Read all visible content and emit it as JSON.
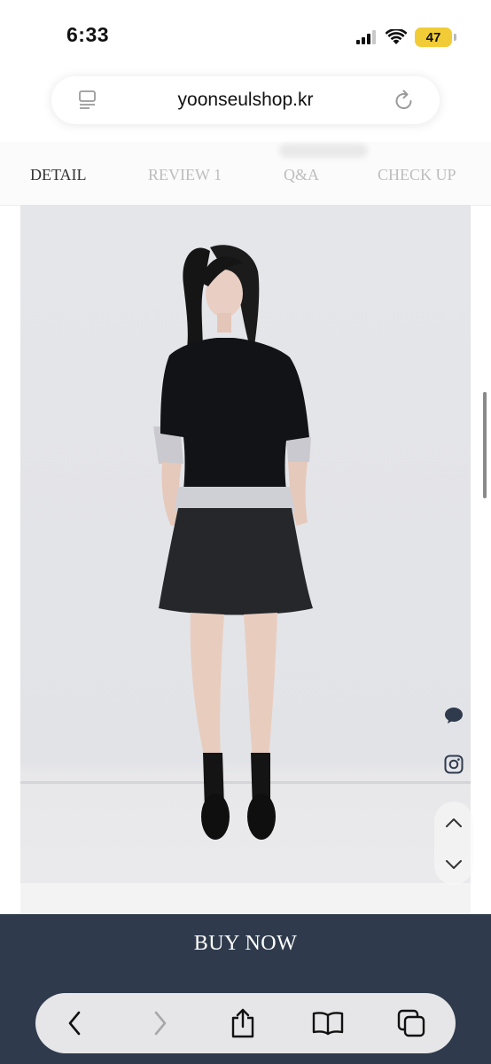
{
  "status_bar": {
    "time": "6:33",
    "battery": "47",
    "signal_icon": "cellular-signal-icon",
    "wifi_icon": "wifi-icon"
  },
  "browser": {
    "url": "yoonseulshop.kr",
    "reader_icon": "reader-icon",
    "reload_icon": "reload-icon"
  },
  "tabs": [
    {
      "label": "DETAIL",
      "active": true
    },
    {
      "label": "REVIEW 1",
      "active": false
    },
    {
      "label": "Q&A",
      "active": false
    },
    {
      "label": "CHECK UP",
      "active": false
    }
  ],
  "product_image": {
    "description_icon": "product-model-photo"
  },
  "floating_buttons": {
    "chat_icon": "chat-bubble-icon",
    "instagram_icon": "instagram-icon",
    "up_icon": "chevron-up-icon",
    "down_icon": "chevron-down-icon"
  },
  "buy_now": {
    "label": "BUY NOW",
    "color": "#2f3b4d"
  },
  "toolbar": {
    "back_icon": "back-chevron-icon",
    "forward_icon": "forward-chevron-icon",
    "share_icon": "share-icon",
    "bookmarks_icon": "bookmarks-book-icon",
    "tabs_icon": "tabs-icon"
  },
  "colors": {
    "battery": "#f2cc37",
    "tab_active": "#333333",
    "tab_inactive": "#bdbdbd"
  }
}
